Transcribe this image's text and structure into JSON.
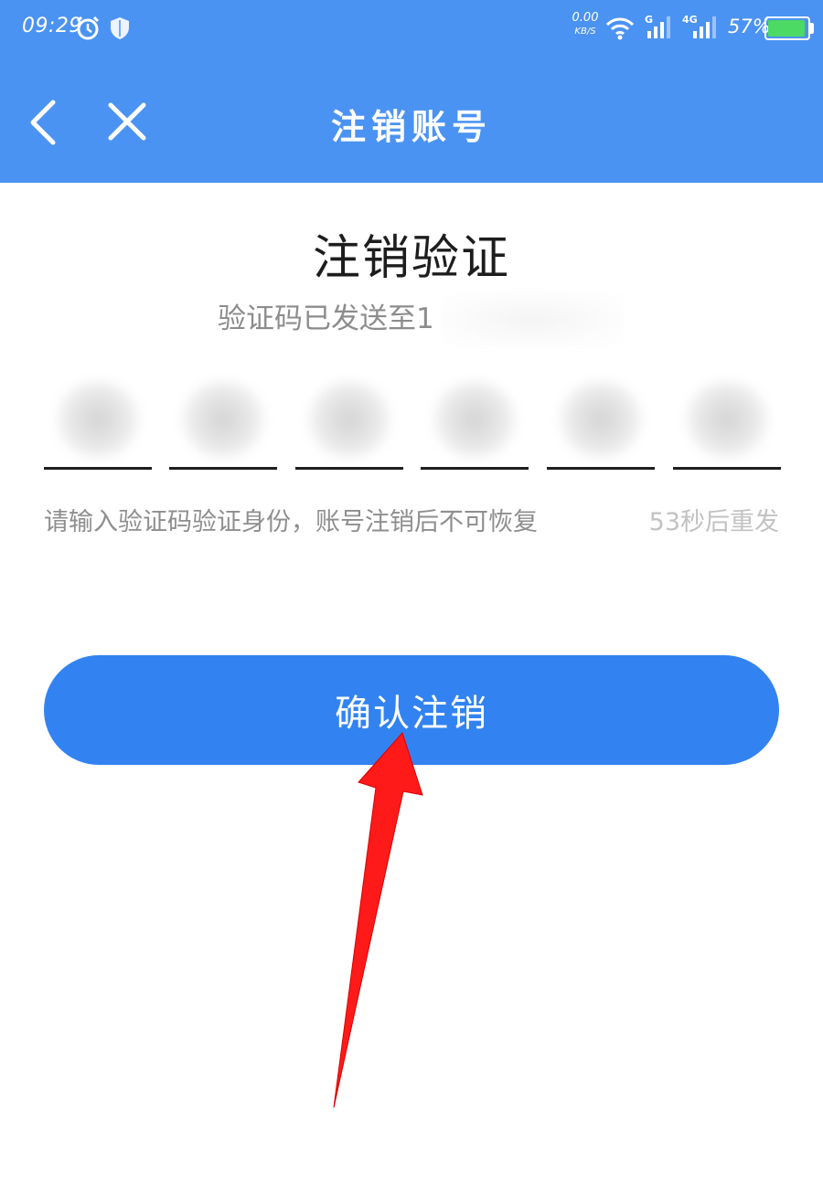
{
  "status_bar": {
    "time": "09:29",
    "net_speed_value": "0.00",
    "net_speed_unit": "KB/S",
    "signal_1_label": "G",
    "signal_2_label": "4G",
    "battery_percent": "57%",
    "icons": [
      "alarm-icon",
      "shield-icon",
      "wifi-icon",
      "signal-icon",
      "battery-icon"
    ]
  },
  "nav": {
    "title": "注销账号",
    "back_icon": "back-chevron-icon",
    "close_icon": "close-icon"
  },
  "main": {
    "heading": "注销验证",
    "sent_to_text": "验证码已发送至1",
    "code_slots": 6,
    "hint": "请输入验证码验证身份，账号注销后不可恢复",
    "resend": "53秒后重发",
    "confirm_button": "确认注销"
  },
  "annotation": {
    "arrow_color": "#ff1a1a"
  },
  "colors": {
    "header_bg": "#4b93f2",
    "button_bg": "#3283f1"
  }
}
